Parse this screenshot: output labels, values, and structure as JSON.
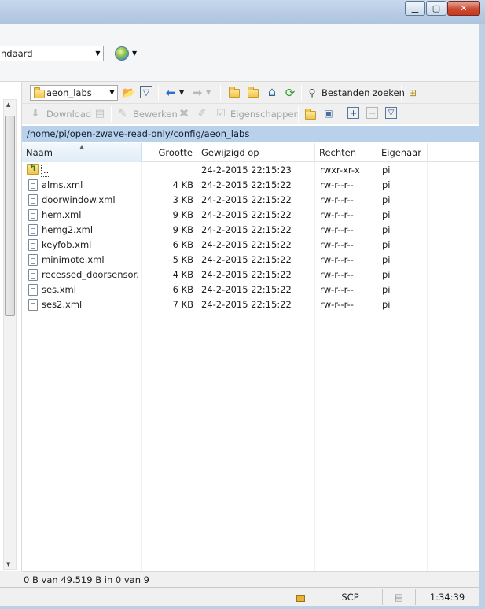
{
  "session": {
    "combo_value": "ndaard"
  },
  "remote": {
    "dir_combo_value": "aeon_labs",
    "find_files_label": "Bestanden zoeken",
    "download_label": "Download",
    "edit_label": "Bewerken",
    "properties_label": "Eigenschappen",
    "path": "/home/pi/open-zwave-read-only/config/aeon_labs",
    "columns": {
      "name": "Naam",
      "size": "Grootte",
      "modified": "Gewijzigd op",
      "rights": "Rechten",
      "owner": "Eigenaar"
    },
    "files": [
      {
        "name": "..",
        "size": "",
        "modified": "24-2-2015 22:15:23",
        "rights": "rwxr-xr-x",
        "owner": "pi",
        "kind": "parent"
      },
      {
        "name": "alms.xml",
        "size": "4 KB",
        "modified": "24-2-2015 22:15:22",
        "rights": "rw-r--r--",
        "owner": "pi",
        "kind": "file"
      },
      {
        "name": "doorwindow.xml",
        "size": "3 KB",
        "modified": "24-2-2015 22:15:22",
        "rights": "rw-r--r--",
        "owner": "pi",
        "kind": "file"
      },
      {
        "name": "hem.xml",
        "size": "9 KB",
        "modified": "24-2-2015 22:15:22",
        "rights": "rw-r--r--",
        "owner": "pi",
        "kind": "file"
      },
      {
        "name": "hemg2.xml",
        "size": "9 KB",
        "modified": "24-2-2015 22:15:22",
        "rights": "rw-r--r--",
        "owner": "pi",
        "kind": "file"
      },
      {
        "name": "keyfob.xml",
        "size": "6 KB",
        "modified": "24-2-2015 22:15:22",
        "rights": "rw-r--r--",
        "owner": "pi",
        "kind": "file"
      },
      {
        "name": "minimote.xml",
        "size": "5 KB",
        "modified": "24-2-2015 22:15:22",
        "rights": "rw-r--r--",
        "owner": "pi",
        "kind": "file"
      },
      {
        "name": "recessed_doorsensor....",
        "size": "4 KB",
        "modified": "24-2-2015 22:15:22",
        "rights": "rw-r--r--",
        "owner": "pi",
        "kind": "file"
      },
      {
        "name": "ses.xml",
        "size": "6 KB",
        "modified": "24-2-2015 22:15:22",
        "rights": "rw-r--r--",
        "owner": "pi",
        "kind": "file"
      },
      {
        "name": "ses2.xml",
        "size": "7 KB",
        "modified": "24-2-2015 22:15:22",
        "rights": "rw-r--r--",
        "owner": "pi",
        "kind": "file"
      }
    ],
    "status": "0 B van 49.519 B in 0 van 9"
  },
  "bottom": {
    "protocol": "SCP",
    "elapsed": "1:34:39"
  },
  "icons": [
    "minimize-icon",
    "maximize-icon",
    "close-icon",
    "globe-icon",
    "folder-icon",
    "filter-icon",
    "back-arrow-icon",
    "forward-arrow-icon",
    "parent-dir-icon",
    "root-dir-icon",
    "home-icon",
    "refresh-icon",
    "binoculars-icon",
    "tree-icon",
    "download-icon",
    "edit-icon",
    "delete-icon",
    "rename-icon",
    "properties-icon",
    "new-folder-icon",
    "add-icon",
    "remove-icon",
    "select-icon",
    "lock-icon",
    "network-icon"
  ],
  "colors": {
    "path_bar": "#b9d1ea",
    "sorted_header": "#dfecf8"
  }
}
